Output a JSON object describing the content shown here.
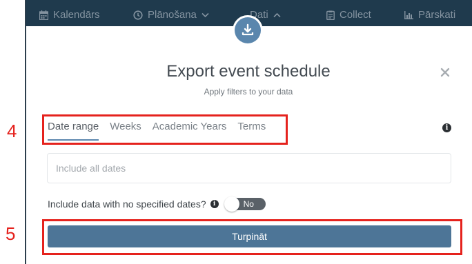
{
  "nav": {
    "items": [
      {
        "label": "Kalendārs",
        "icon": "calendar-icon"
      },
      {
        "label": "Plānošana",
        "icon": "clock-icon",
        "caret": "⌄"
      },
      {
        "label": "Dati",
        "icon": "database-icon",
        "caret": "⌃"
      },
      {
        "label": "Collect",
        "icon": "clipboard-icon"
      },
      {
        "label": "Pārskati",
        "icon": "bar-chart-icon"
      }
    ]
  },
  "modal": {
    "icon": "download-icon",
    "title": "Export event schedule",
    "subtitle": "Apply filters to your data",
    "close_icon": "close-icon",
    "tabs": [
      {
        "label": "Date range",
        "active": true
      },
      {
        "label": "Weeks",
        "active": false
      },
      {
        "label": "Academic Years",
        "active": false
      },
      {
        "label": "Terms",
        "active": false
      }
    ],
    "info_icon_glyph": "i",
    "date_input": {
      "placeholder": "Include all dates",
      "value": ""
    },
    "no_dates": {
      "label": "Include data with no specified dates?",
      "info_glyph": "i",
      "toggle_text": "No",
      "toggle_on": false
    },
    "submit_label": "Turpināt"
  },
  "annotations": [
    {
      "number": "4",
      "target": "tabs"
    },
    {
      "number": "5",
      "target": "submit-button"
    }
  ],
  "colors": {
    "nav_bg": "#1f3a4d",
    "accent": "#5a86ad",
    "button": "#4d7597",
    "annotation": "#e5221d"
  }
}
